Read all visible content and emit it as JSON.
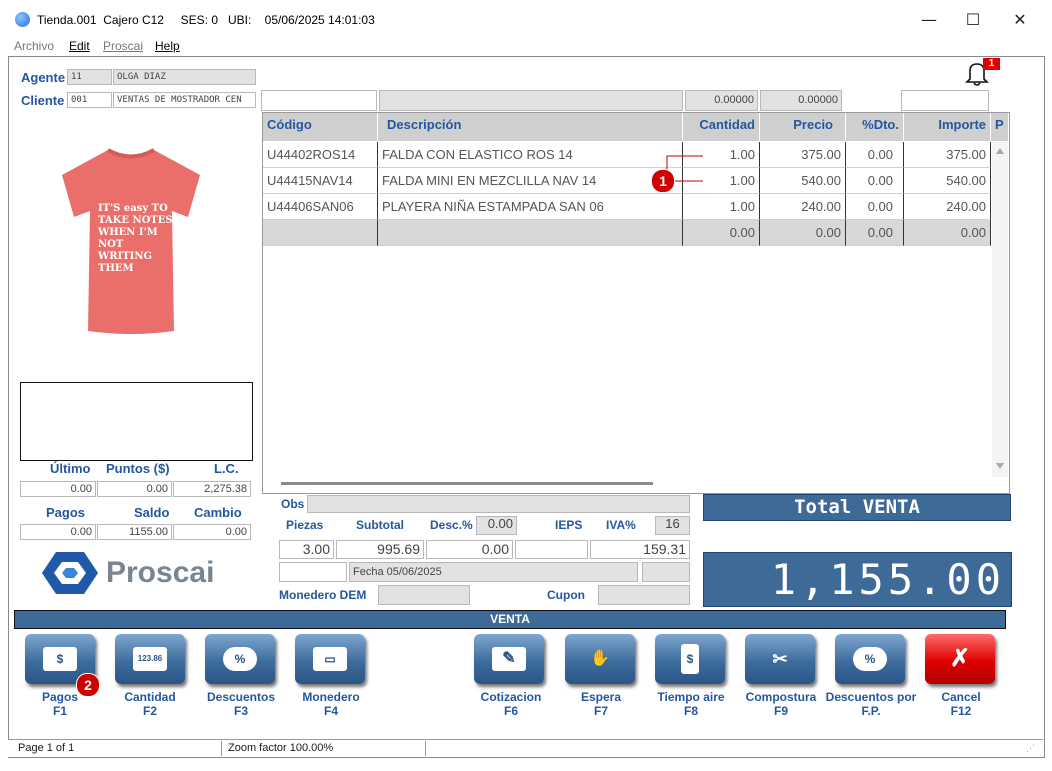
{
  "window": {
    "title": "Tienda.001  Cajero C12     SES: 0   UBI:    05/06/2025 14:01:03",
    "min": "—",
    "max": "☐",
    "close": "✕"
  },
  "menu": [
    "Archivo",
    "Edit",
    "Proscai",
    "Help"
  ],
  "notifications": {
    "count": "1"
  },
  "agente": {
    "label": "Agente",
    "code": "11",
    "name": "OLGA DIAZ"
  },
  "cliente": {
    "label": "Cliente",
    "code": "001",
    "name": "VENTAS DE MOSTRADOR CEN"
  },
  "product_image": {
    "caption_lines": [
      "IT'S easy TO",
      "TAKE NOTES",
      "WHEN I'M NOT",
      "WRITING THEM"
    ],
    "color": "#ea6f6a"
  },
  "search_row": {
    "f1": "",
    "f2": "",
    "f3": "0.00000",
    "f4": "0.00000",
    "f5": ""
  },
  "grid": {
    "headers": [
      "Código",
      "Descripción",
      "Cantidad",
      "Precio",
      "%Dto.",
      "Importe",
      "P"
    ],
    "rows": [
      [
        "U44402ROS14",
        "FALDA CON ELASTICO ROS 14",
        "1.00",
        "375.00",
        "0.00",
        "375.00"
      ],
      [
        "U44415NAV14",
        "FALDA MINI EN MEZCLILLA NAV 14",
        "1.00",
        "540.00",
        "0.00",
        "540.00"
      ],
      [
        "U44406SAN06",
        "PLAYERA NIÑA ESTAMPADA SAN 06",
        "1.00",
        "240.00",
        "0.00",
        "240.00"
      ]
    ],
    "totals": [
      "",
      "",
      "0.00",
      "0.00",
      "0.00",
      "0.00"
    ]
  },
  "callouts": {
    "one": "1",
    "two": "2"
  },
  "stats": {
    "ultimo_label": "Último",
    "puntos_label": "Puntos ($)",
    "lc_label": "L.C.",
    "ultimo": "0.00",
    "puntos": "0.00",
    "lc": "2,275.38",
    "pagos_label": "Pagos",
    "saldo_label": "Saldo",
    "cambio_label": "Cambio",
    "pagos": "0.00",
    "saldo": "1155.00",
    "cambio": "0.00"
  },
  "logo": {
    "text": "Proscai"
  },
  "summary": {
    "obs_label": "Obs",
    "obs": "",
    "piezas_label": "Piezas",
    "subtotal_label": "Subtotal",
    "desc_label": "Desc.%",
    "desc_pct": "0.00",
    "ieps_label": "IEPS",
    "iva_label": "IVA%",
    "iva_pct": "16",
    "piezas": "3.00",
    "subtotal": "995.69",
    "descuento": "0.00",
    "ieps": "",
    "iva": "159.31",
    "fecha": "Fecha 05/06/2025",
    "monedero_label": "Monedero DEM",
    "monedero": "",
    "cupon_label": "Cupon",
    "cupon": ""
  },
  "total": {
    "label": "Total VENTA",
    "amount": "1,155.00"
  },
  "mode_bar": "VENTA",
  "buttons": [
    {
      "label": "Pagos",
      "key": "F1",
      "icon": "$"
    },
    {
      "label": "Cantidad",
      "key": "F2",
      "icon": "123.86"
    },
    {
      "label": "Descuentos",
      "key": "F3",
      "icon": "%"
    },
    {
      "label": "Monedero",
      "key": "F4",
      "icon": "▭"
    },
    {
      "label": "Cotizacion",
      "key": "F6",
      "icon": "✎"
    },
    {
      "label": "Espera",
      "key": "F7",
      "icon": "✋"
    },
    {
      "label": "Tiempo aire",
      "key": "F8",
      "icon": "$"
    },
    {
      "label": "Compostura",
      "key": "F9",
      "icon": "✂"
    },
    {
      "label": "Descuentos por",
      "key": "F.P.",
      "icon": "%"
    },
    {
      "label": "Cancel",
      "key": "F12",
      "icon": "✗"
    }
  ],
  "status": {
    "page": "Page 1 of 1",
    "zoom": "Zoom factor 100.00%"
  }
}
